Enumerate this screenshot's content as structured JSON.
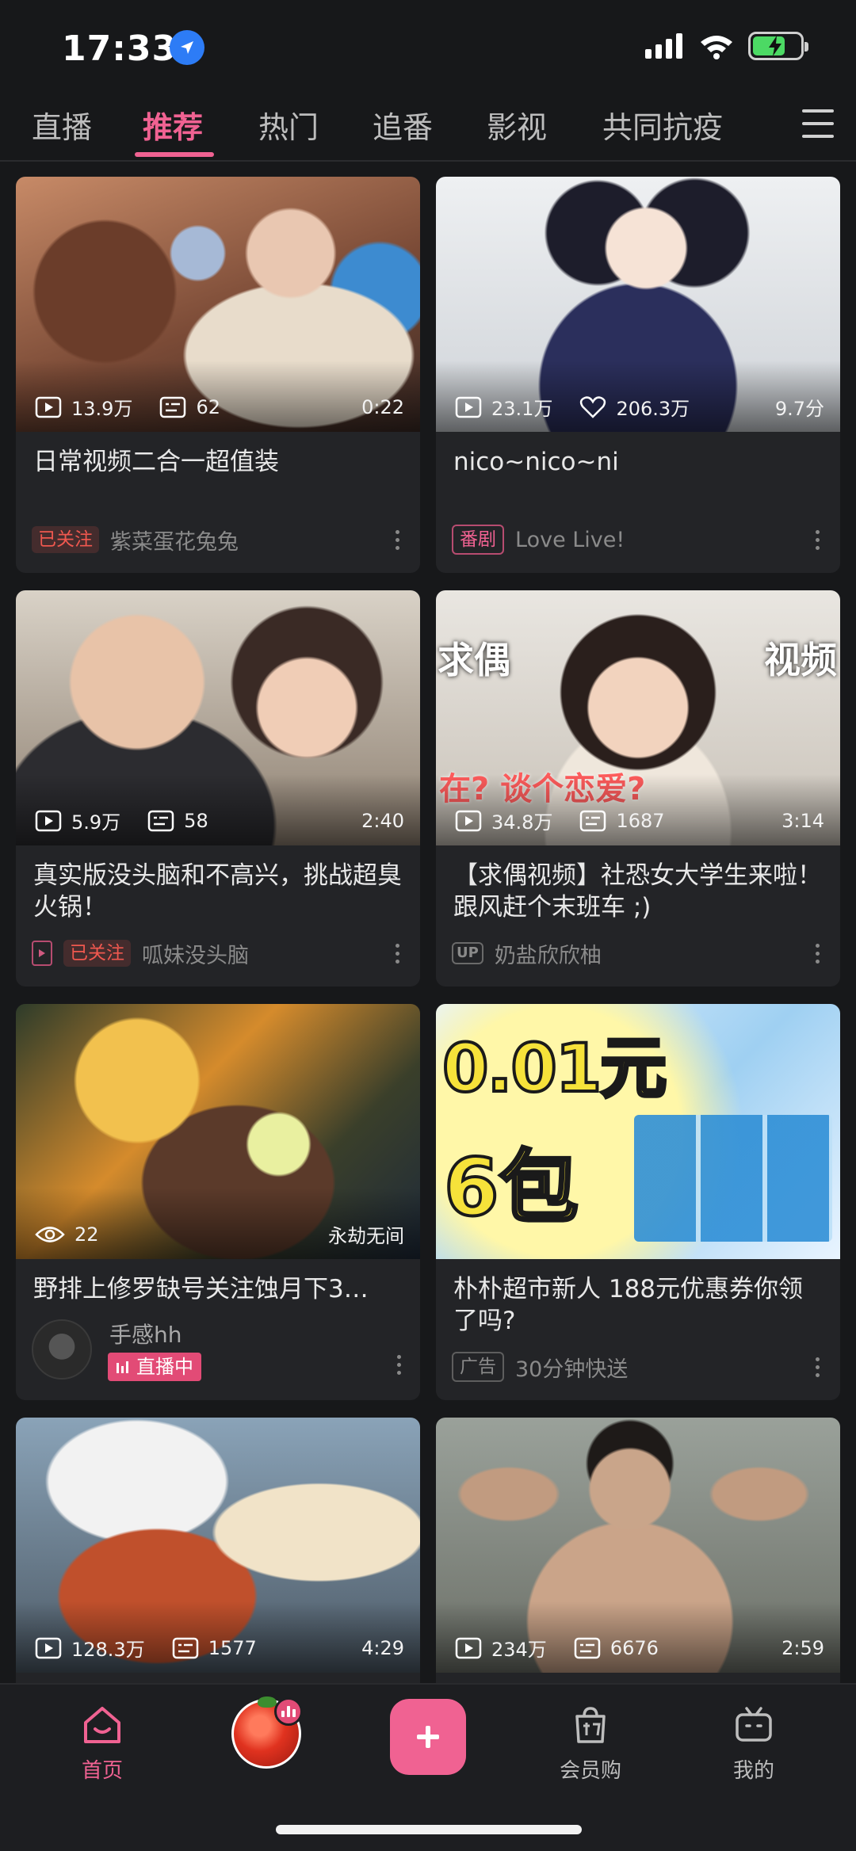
{
  "status_bar": {
    "time": "17:33"
  },
  "top_tabs": [
    "直播",
    "推荐",
    "热门",
    "追番",
    "影视",
    "共同抗疫"
  ],
  "active_tab": "推荐",
  "cards": [
    {
      "views": "13.9万",
      "danmaku": "62",
      "duration": "0:22",
      "title": "日常视频二合一超值装",
      "tag": "已关注",
      "author": "紫菜蛋花兔兔"
    },
    {
      "views": "23.1万",
      "likes": "206.3万",
      "score": "9.7分",
      "title": "nico~nico~ni",
      "tag": "番剧",
      "author": "Love Live!"
    },
    {
      "views": "5.9万",
      "danmaku": "58",
      "duration": "2:40",
      "title": "真实版没头脑和不高兴，挑战超臭火锅！",
      "tag": "已关注",
      "author": "呱妹没头脑"
    },
    {
      "views": "34.8万",
      "danmaku": "1687",
      "duration": "3:14",
      "title": "【求偶视频】社恐女大学生来啦！跟风赶个末班车 ;)",
      "tag": "UP",
      "author": "奶盐欣欣柚",
      "thumb_text_left": "求偶",
      "thumb_text_right": "视频",
      "thumb_text_bottom": "在? 谈个恋爱?"
    },
    {
      "watching": "22",
      "corner_label": "永劫无间",
      "title": "野排上修罗缺号关注蚀月下3…",
      "author": "手感hh",
      "live_label": "直播中"
    },
    {
      "title": "朴朴超市新人 188元优惠券你领了吗?",
      "tag": "广告",
      "author": "30分钟快送",
      "thumb_text_top": "0.01元",
      "thumb_text_bottom": "6包"
    },
    {
      "views": "128.3万",
      "danmaku": "1577",
      "duration": "4:29"
    },
    {
      "views": "234万",
      "danmaku": "6676",
      "duration": "2:59"
    }
  ],
  "bottom_nav": {
    "home": "首页",
    "vip_shop": "会员购",
    "mine": "我的"
  },
  "colors": {
    "accent": "#f06292",
    "followed": "#f0584f",
    "background": "#17181a",
    "card": "#232427"
  }
}
